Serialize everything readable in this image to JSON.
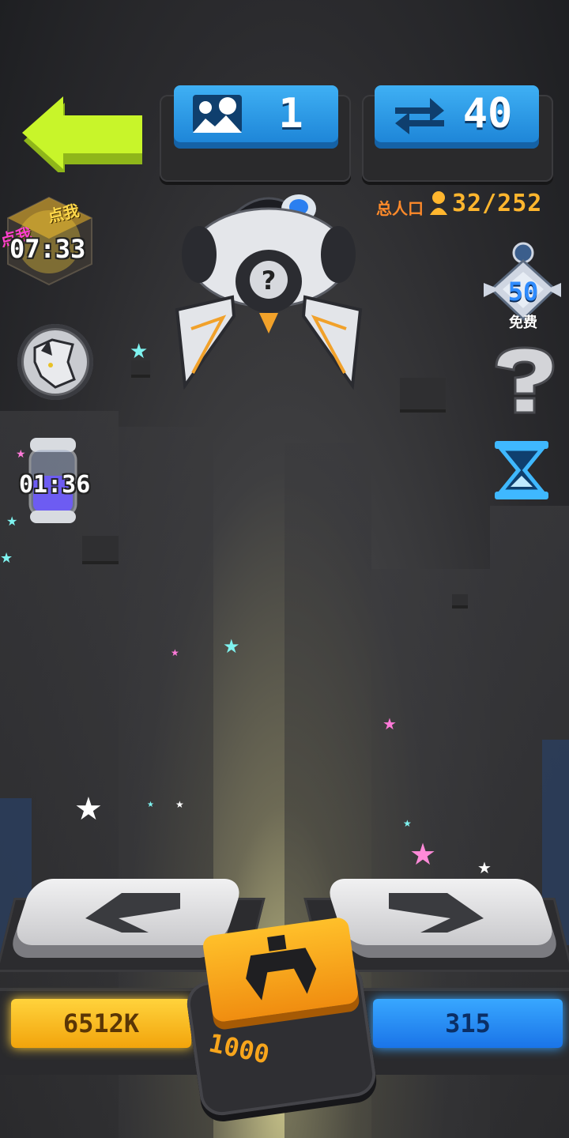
{
  "top_bar": {
    "level_value": "1",
    "swap_value": "40",
    "population_label": "总人口",
    "population_value": "32/252"
  },
  "left_panel": {
    "event_click_label": "点我",
    "event_click_label_2": "点我",
    "event_timer": "07:33",
    "jar_timer": "01:36"
  },
  "right_panel": {
    "badge_number": "50",
    "badge_label": "免费"
  },
  "bottom": {
    "left_value": "6512K",
    "right_value": "315",
    "center_cost": "1000"
  },
  "colors": {
    "accent_yellow": "#ffd33c",
    "accent_blue": "#1e86d8",
    "back_arrow": "#c8f52a",
    "population_orange": "#ff8a2a"
  },
  "icons": [
    "back-arrow-icon",
    "landscape-icon",
    "swap-icon",
    "population-person-icon",
    "wolf-avatar-icon",
    "energy-jar-icon",
    "rank-badge-icon",
    "question-mark-icon",
    "hourglass-icon",
    "left-arrow-icon",
    "right-arrow-icon",
    "claw-icon",
    "robot-pod"
  ]
}
